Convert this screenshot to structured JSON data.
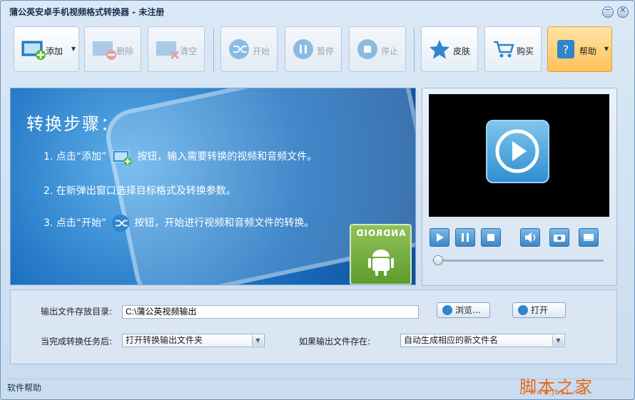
{
  "window": {
    "title": "蒲公英安卓手机视频格式转换器 - 未注册"
  },
  "toolbar": {
    "add": "添加",
    "delete": "删除",
    "clear": "清空",
    "start": "开始",
    "pause": "暂停",
    "stop": "停止",
    "skin": "皮肤",
    "buy": "购买",
    "help": "帮助"
  },
  "banner": {
    "title": "转换步骤：",
    "step1a": "1. 点击“添加”",
    "step1b": "按钮，输入需要转换的视频和音频文件。",
    "step2": "2. 在新弹出窗口选择目标格式及转换参数。",
    "step3a": "3. 点击“开始”",
    "step3b": "按钮，开始进行视频和音频文件的转换。",
    "android_text": "ANDROID"
  },
  "settings": {
    "output_dir_label": "输出文件存放目录:",
    "output_dir_value": "C:\\蒲公英视频输出",
    "browse": "浏览...",
    "open": "打开",
    "after_done_label": "当完成转换任务后:",
    "after_done_value": "打开转换输出文件夹",
    "if_exists_label": "如果输出文件存在:",
    "if_exists_value": "自动生成相应的新文件名"
  },
  "status": {
    "text": "软件帮助"
  },
  "watermark": {
    "text": "脚本之家",
    "url": "www.jb51.net"
  },
  "colors": {
    "accent": "#2f86cd",
    "help_button": "#ffc25a",
    "banner": "#1a6fbf"
  }
}
